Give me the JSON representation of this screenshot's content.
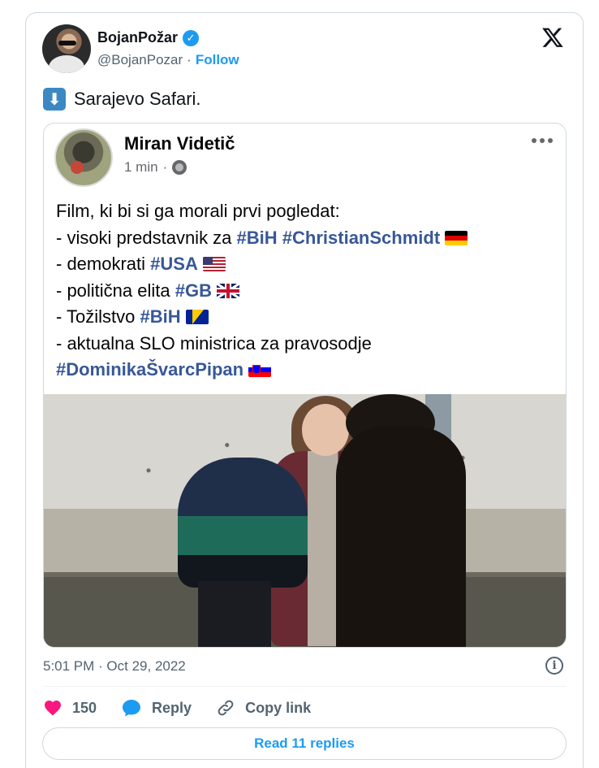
{
  "author": {
    "display_name": "BojanPožar",
    "handle": "@BojanPozar",
    "separator": "·",
    "follow_label": "Follow",
    "verified_color": "#1d9bf0"
  },
  "tweet": {
    "icon": "down-arrow-button-icon",
    "text": "Sarajevo Safari."
  },
  "embedded_post": {
    "name": "Miran Videtič",
    "time": "1 min",
    "separator": "·",
    "lines": [
      {
        "text": "Film, ki bi si ga morali prvi pogledat:"
      },
      {
        "text": "- visoki predstavnik za ",
        "tags": [
          "#BiH",
          "#ChristianSchmidt"
        ],
        "flag": "de"
      },
      {
        "text": "- demokrati ",
        "tags": [
          "#USA"
        ],
        "flag": "us"
      },
      {
        "text": "- politična elita ",
        "tags": [
          "#GB"
        ],
        "flag": "gb"
      },
      {
        "text": "- Tožilstvo ",
        "tags": [
          "#BiH"
        ],
        "flag": "ba"
      },
      {
        "text": "- aktualna SLO ministrica za pravosodje"
      },
      {
        "text": "",
        "tags": [
          "#DominikaŠvarcPipan"
        ],
        "flag": "si"
      }
    ],
    "tag_color": "#385898"
  },
  "timestamp": "5:01 PM · Oct 29, 2022",
  "actions": {
    "like_count": "150",
    "reply_label": "Reply",
    "copy_link_label": "Copy link",
    "like_color": "#f91880",
    "reply_color": "#1d9bf0"
  },
  "read_replies_label": "Read 11 replies"
}
